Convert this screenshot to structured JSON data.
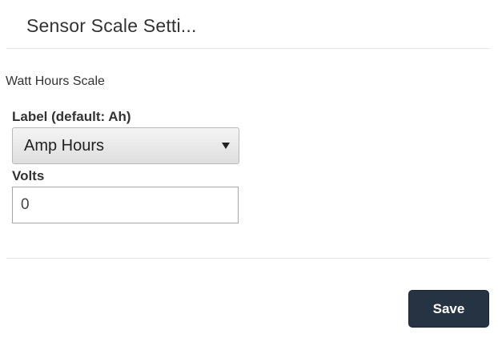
{
  "dialog": {
    "title": "Sensor Scale Setti..."
  },
  "section": {
    "heading": "Watt Hours Scale"
  },
  "label_field": {
    "caption": "Label (default: Ah)",
    "selected_value": "Amp Hours",
    "arrow_icon": "dropdown-arrow-icon"
  },
  "volts_field": {
    "caption": "Volts",
    "value": "0"
  },
  "actions": {
    "save_label": "Save"
  },
  "colors": {
    "save_button_bg": "#263342",
    "divider": "#e6e6e6",
    "text": "#333333"
  }
}
